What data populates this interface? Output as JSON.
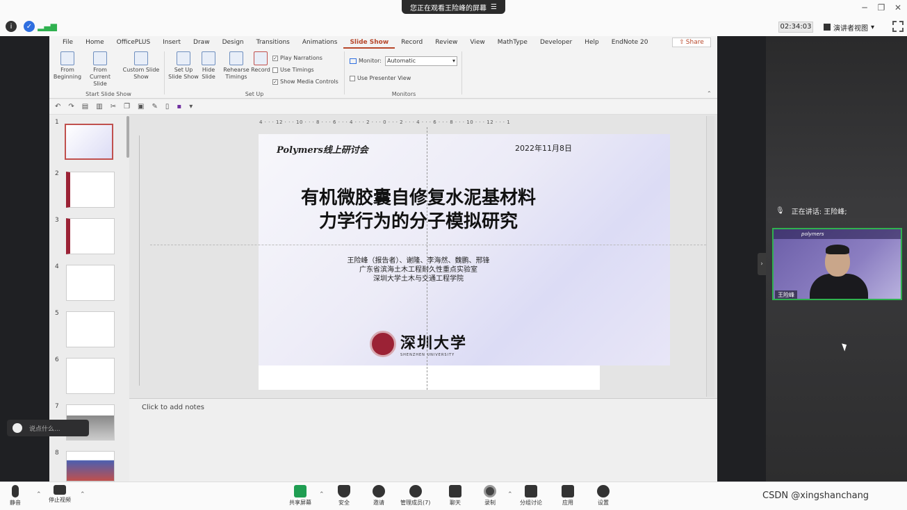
{
  "meeting": {
    "share_banner": "您正在观看王险峰的屏幕",
    "timer": "02:34:03",
    "presenter_view": "演讲者视图",
    "window_min": "─",
    "window_restore": "❐",
    "window_close": "✕"
  },
  "ppt": {
    "tabs": [
      "File",
      "Home",
      "OfficePLUS",
      "Insert",
      "Draw",
      "Design",
      "Transitions",
      "Animations",
      "Slide Show",
      "Record",
      "Review",
      "View",
      "MathType",
      "Developer",
      "Help",
      "EndNote 20"
    ],
    "active_tab": "Slide Show",
    "share_label": "Share",
    "ribbon": {
      "from_beginning": "From Beginning",
      "from_current": "From Current Slide",
      "custom_show": "Custom Slide Show",
      "group_start": "Start Slide Show",
      "setup_show": "Set Up Slide Show",
      "hide_slide": "Hide Slide",
      "rehearse": "Rehearse Timings",
      "record": "Record",
      "play_narrations": "Play Narrations",
      "use_timings": "Use Timings",
      "show_media": "Show Media Controls",
      "group_setup": "Set Up",
      "monitor_label": "Monitor:",
      "monitor_value": "Automatic",
      "presenter_view": "Use Presenter View",
      "group_monitors": "Monitors"
    },
    "ruler_text": "4 · · · 12 · · · 10 · · · 8 · · · 6 · · · 4 · · · 2 · · · 0 · · · 2 · · · 4 · · · 6 · · · 8 · · · 10 · · · 12 · · · 1",
    "thumbnails": [
      "1",
      "2",
      "3",
      "4",
      "5",
      "6",
      "7",
      "8"
    ],
    "notes_placeholder": "Click to add notes"
  },
  "slide": {
    "conference": "Polymers线上研讨会",
    "date": "2022年11月8日",
    "title_line1": "有机微胶囊自修复水泥基材料",
    "title_line2": "力学行为的分子模拟研究",
    "authors": "王险峰（报告者）、谢隆、李海然、魏鹏、邢锋",
    "lab": "广东省滨海土木工程耐久性重点实验室",
    "school": "深圳大学土木与交通工程学院",
    "logo_text": "深圳大学",
    "logo_sub": "SHENZHEN UNIVERSITY"
  },
  "participants": {
    "speaking": "正在讲话: 王险峰;",
    "tile_header": "polymers",
    "tile_name": "王险峰"
  },
  "chat": {
    "placeholder": "说点什么..."
  },
  "toolbar": {
    "mute": "静音",
    "stop_video": "停止视频",
    "share_screen": "共享屏幕",
    "security": "安全",
    "invite": "邀请",
    "manage_members": "管理成员(7)",
    "chat": "聊天",
    "record": "录制",
    "breakout": "分组讨论",
    "apps": "应用",
    "settings": "设置"
  },
  "watermark": "CSDN @xingshanchang"
}
